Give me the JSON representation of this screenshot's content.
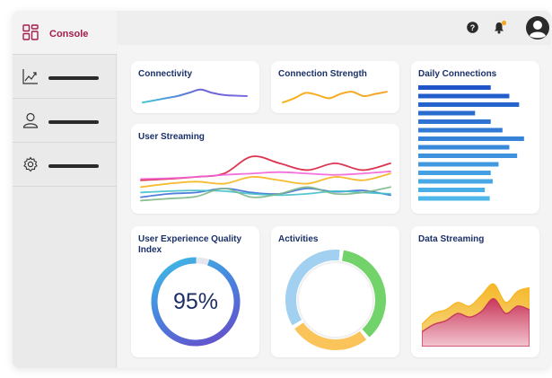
{
  "sidebar": {
    "items": [
      {
        "label": "Console",
        "icon": "dashboard-grid-icon",
        "active": true
      },
      {
        "label": "",
        "icon": "trend-chart-icon"
      },
      {
        "label": "",
        "icon": "user-icon"
      },
      {
        "label": "",
        "icon": "gear-icon"
      }
    ]
  },
  "topbar": {
    "icons": [
      "help-icon",
      "notification-bell-icon",
      "user-avatar-icon"
    ],
    "notification_dot_color": "#f5a623"
  },
  "cards": {
    "connectivity": {
      "title": "Connectivity"
    },
    "connection_strength": {
      "title": "Connection Strength"
    },
    "daily_connections": {
      "title": "Daily Connections"
    },
    "user_streaming": {
      "title": "User Streaming"
    },
    "ux_quality": {
      "title": "User Experience Quality Index",
      "value": "95%",
      "percent": 0.95
    },
    "activities": {
      "title": "Activities"
    },
    "data_streaming": {
      "title": "Data Streaming"
    }
  },
  "chart_data": [
    {
      "type": "line",
      "title": "Connectivity",
      "series": [
        {
          "values": [
            2,
            3,
            4,
            5,
            6.5,
            8,
            6.5,
            5.5,
            5.2,
            5
          ]
        }
      ]
    },
    {
      "type": "line",
      "title": "Connection Strength",
      "series": [
        {
          "values": [
            2,
            4,
            6.5,
            5.5,
            4,
            6,
            7,
            5,
            6,
            7
          ]
        }
      ]
    },
    {
      "type": "bar",
      "orientation": "horizontal",
      "title": "Daily Connections",
      "values": [
        74,
        93,
        103,
        58,
        74,
        86,
        108,
        93,
        101,
        82,
        74,
        76,
        68,
        73
      ]
    },
    {
      "type": "line",
      "title": "User Streaming",
      "series": [
        {
          "color": "#d81f3d",
          "values": [
            4,
            4.2,
            4.5,
            5,
            7.5,
            6.5,
            5.5,
            6.5,
            5.5,
            6.5
          ]
        },
        {
          "color": "#f263d8",
          "values": [
            4.2,
            4.3,
            4.5,
            4.8,
            5,
            5.2,
            5,
            4.8,
            5,
            5.3
          ]
        },
        {
          "color": "#f5b41a",
          "values": [
            3,
            3.5,
            3.8,
            3.5,
            4.5,
            4,
            3.5,
            4.5,
            4,
            5
          ]
        },
        {
          "color": "#3f6fd8",
          "values": [
            1.5,
            2,
            2.2,
            2.8,
            2.2,
            2,
            2.8,
            2.3,
            2.5,
            1.8
          ]
        },
        {
          "color": "#42c0c8",
          "values": [
            2.2,
            2.4,
            2.5,
            2.4,
            2,
            1.8,
            2,
            2.4,
            2.2,
            2
          ]
        },
        {
          "color": "#7fb88b",
          "values": [
            1,
            1.3,
            1.6,
            2.8,
            1.5,
            2,
            3,
            2,
            2.2,
            3
          ]
        }
      ]
    },
    {
      "type": "pie",
      "title": "Activities",
      "values": [
        37,
        27,
        36
      ],
      "colors": [
        "#72d36a",
        "#fbc45a",
        "#a2d0f0"
      ]
    },
    {
      "type": "area",
      "title": "Data Streaming",
      "series": [
        {
          "color": "#f5b829",
          "values": [
            3,
            4.5,
            5,
            6,
            5.5,
            7,
            8.5,
            6,
            7.5,
            8
          ]
        },
        {
          "color": "#c9385b",
          "values": [
            2,
            3,
            3.5,
            4.5,
            4,
            4.8,
            6.5,
            4.5,
            5.5,
            5
          ]
        }
      ]
    }
  ]
}
